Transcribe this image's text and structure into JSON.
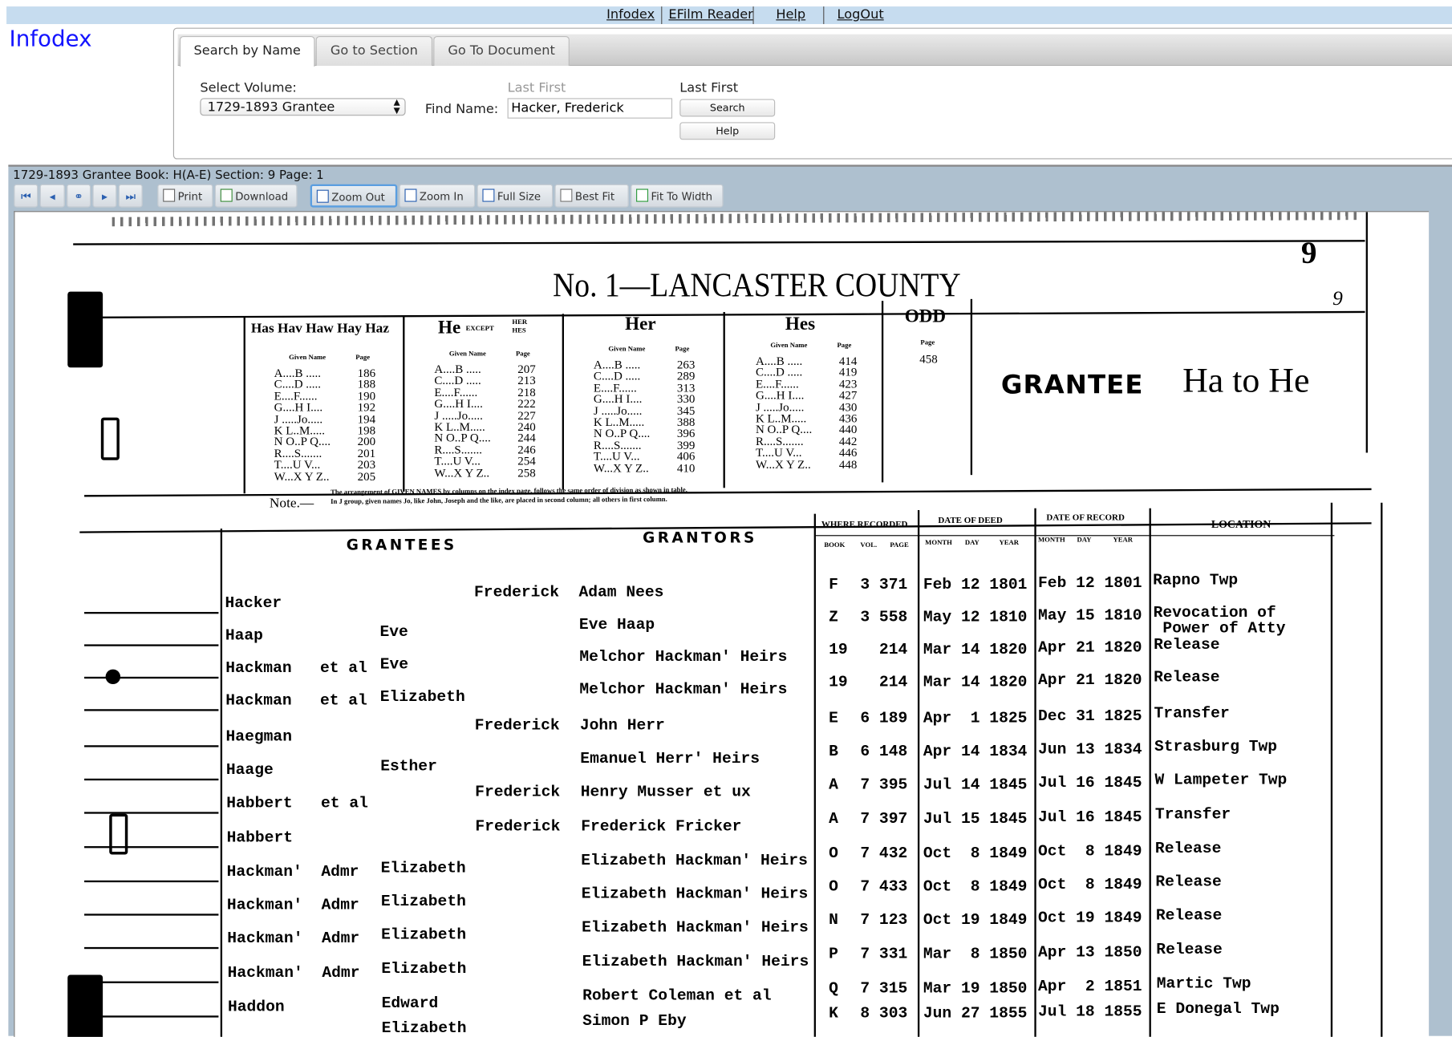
{
  "nav": {
    "links": [
      "Infodex",
      "EFilm Reader",
      "Help",
      "LogOut"
    ]
  },
  "logo": "Infodex",
  "tabs": [
    {
      "label": "Search by Name",
      "active": true
    },
    {
      "label": "Go to Section"
    },
    {
      "label": "Go To Document"
    }
  ],
  "form": {
    "volume_label": "Select Volume:",
    "volume_value": "1729-1893 Grantee",
    "find_label": "Find Name:",
    "find_hint": "Last First",
    "find_value": "Hacker, Frederick",
    "hint2": "Last First",
    "search_button": "Search",
    "help_button": "Help"
  },
  "viewer": {
    "title": "1729-1893 Grantee Book: H(A-E) Section: 9 Page: 1",
    "toolbar": [
      {
        "label": "",
        "icon": "first-page-icon"
      },
      {
        "label": "",
        "icon": "previous-page-icon"
      },
      {
        "label": "",
        "icon": "binoculars-find-icon"
      },
      {
        "label": "",
        "icon": "next-page-icon"
      },
      {
        "label": "",
        "icon": "last-page-icon"
      },
      {
        "label": "Print",
        "icon": "printer-icon"
      },
      {
        "label": "Download",
        "icon": "download-icon"
      },
      {
        "label": "Zoom Out",
        "icon": "zoom-out-icon",
        "selected": true
      },
      {
        "label": "Zoom In",
        "icon": "zoom-in-icon"
      },
      {
        "label": "Full Size",
        "icon": "full-size-icon"
      },
      {
        "label": "Best Fit",
        "icon": "best-fit-icon"
      },
      {
        "label": "Fit To Width",
        "icon": "fit-width-icon"
      }
    ]
  },
  "document": {
    "page_number": "9",
    "page_number_handwritten": "9",
    "county_title": "No. 1—LANCASTER COUNTY",
    "grantee_label": "GRANTEE",
    "grantee_range": "Ha to He",
    "index_sub_given": "Given Name",
    "index_sub_page": "Page",
    "index_blocks": [
      {
        "title": "Has Hav Haw Hay Haz",
        "pages": [
          "186",
          "188",
          "190",
          "192",
          "194",
          "198",
          "200",
          "201",
          "203",
          "205"
        ]
      },
      {
        "title": "He",
        "except": "EXCEPT",
        "except_names": "HER\nHES",
        "pages": [
          "207",
          "213",
          "218",
          "222",
          "227",
          "240",
          "244",
          "246",
          "254",
          "258"
        ]
      },
      {
        "title": "Her",
        "pages": [
          "263",
          "289",
          "313",
          "330",
          "345",
          "388",
          "396",
          "399",
          "406",
          "410"
        ]
      },
      {
        "title": "Hes",
        "pages": [
          "414",
          "419",
          "423",
          "427",
          "430",
          "436",
          "440",
          "442",
          "446",
          "448"
        ]
      }
    ],
    "index_ranges": [
      "A....B .....",
      "C....D .....",
      "E....F......",
      "G....H I....",
      "J .....Jo.....",
      "K L..M.....",
      "N O..P Q....",
      "R....S.......",
      "T....U V...",
      "W...X Y Z.."
    ],
    "odd": {
      "title": "ODD",
      "sub": "Page",
      "page": "458"
    },
    "note_label": "Note.—",
    "note_text_1": "The arrangement of GIVEN NAMES by columns on the index page, follows the same order of division as shown in table.",
    "note_text_2": "In J group, given names Jo, like John, Joseph and the like, are placed in second column; all others in first column.",
    "headers": {
      "grantees": "GRANTEES",
      "grantors": "GRANTORS",
      "where_recorded": "WHERE RECORDED",
      "book": "BOOK",
      "vol": "VOL.",
      "page": "PAGE",
      "date_of_deed": "DATE OF DEED",
      "date_of_record": "DATE OF RECORD",
      "month": "MONTH",
      "day": "DAY",
      "year": "YEAR",
      "location": "LOCATION"
    },
    "rows": [
      {
        "surname": "Hacker",
        "given1": "",
        "given2": "Frederick",
        "grantor": "Adam Nees",
        "book": "F",
        "volpage": "3 371",
        "deed": "Feb 12 1801",
        "record": "Feb 12 1801",
        "location": "Rapno Twp"
      },
      {
        "surname": "Haap",
        "given1": "Eve",
        "given2": "",
        "grantor": "Eve Haap",
        "book": "Z",
        "volpage": "3 558",
        "deed": "May 12 1810",
        "record": "May 15 1810",
        "location": "Revocation of\n Power of Atty"
      },
      {
        "surname": "Hackman   et al",
        "given1": "Eve",
        "given2": "",
        "grantor": "Melchor Hackman' Heirs",
        "book": "19",
        "volpage": "  214",
        "deed": "Mar 14 1820",
        "record": "Apr 21 1820",
        "location": "Release"
      },
      {
        "surname": "Hackman   et al",
        "given1": "Elizabeth",
        "given2": "",
        "grantor": "Melchor Hackman' Heirs",
        "book": "19",
        "volpage": "  214",
        "deed": "Mar 14 1820",
        "record": "Apr 21 1820",
        "location": "Release"
      },
      {
        "surname": "Haegman",
        "given1": "",
        "given2": "Frederick",
        "grantor": "John Herr",
        "book": "E",
        "volpage": "6 189",
        "deed": "Apr  1 1825",
        "record": "Dec 31 1825",
        "location": "Transfer"
      },
      {
        "surname": "Haage",
        "given1": "Esther",
        "given2": "",
        "grantor": "Emanuel Herr' Heirs",
        "book": "B",
        "volpage": "6 148",
        "deed": "Apr 14 1834",
        "record": "Jun 13 1834",
        "location": "Strasburg Twp"
      },
      {
        "surname": "Habbert   et al",
        "given1": "",
        "given2": "Frederick",
        "grantor": "Henry Musser et ux",
        "book": "A",
        "volpage": "7 395",
        "deed": "Jul 14 1845",
        "record": "Jul 16 1845",
        "location": "W Lampeter Twp"
      },
      {
        "surname": "Habbert",
        "given1": "",
        "given2": "Frederick",
        "grantor": "Frederick Fricker",
        "book": "A",
        "volpage": "7 397",
        "deed": "Jul 15 1845",
        "record": "Jul 16 1845",
        "location": "Transfer"
      },
      {
        "surname": "Hackman'  Admr",
        "given1": "Elizabeth",
        "given2": "",
        "grantor": "Elizabeth Hackman' Heirs",
        "book": "O",
        "volpage": "7 432",
        "deed": "Oct  8 1849",
        "record": "Oct  8 1849",
        "location": "Release"
      },
      {
        "surname": "Hackman'  Admr",
        "given1": "Elizabeth",
        "given2": "",
        "grantor": "Elizabeth Hackman' Heirs",
        "book": "O",
        "volpage": "7 433",
        "deed": "Oct  8 1849",
        "record": "Oct  8 1849",
        "location": "Release"
      },
      {
        "surname": "Hackman'  Admr",
        "given1": "Elizabeth",
        "given2": "",
        "grantor": "Elizabeth Hackman' Heirs",
        "book": "N",
        "volpage": "7 123",
        "deed": "Oct 19 1849",
        "record": "Oct 19 1849",
        "location": "Release"
      },
      {
        "surname": "Hackman'  Admr",
        "given1": "Elizabeth",
        "given2": "",
        "grantor": "Elizabeth Hackman' Heirs",
        "book": "P",
        "volpage": "7 331",
        "deed": "Mar  8 1850",
        "record": "Apr 13 1850",
        "location": "Release"
      },
      {
        "surname": "Haddon",
        "given1": "Edward",
        "given2": "",
        "grantor": "Robert Coleman et al",
        "book": "Q",
        "volpage": "7 315",
        "deed": "Mar 19 1850",
        "record": "Apr  2 1851",
        "location": "Martic Twp"
      },
      {
        "surname": "",
        "given1": "Elizabeth",
        "given2": "",
        "grantor": "Simon P Eby",
        "book": "K",
        "volpage": "8 303",
        "deed": "Jun 27 1855",
        "record": "Jul 18 1855",
        "location": "E Donegal Twp"
      }
    ]
  }
}
